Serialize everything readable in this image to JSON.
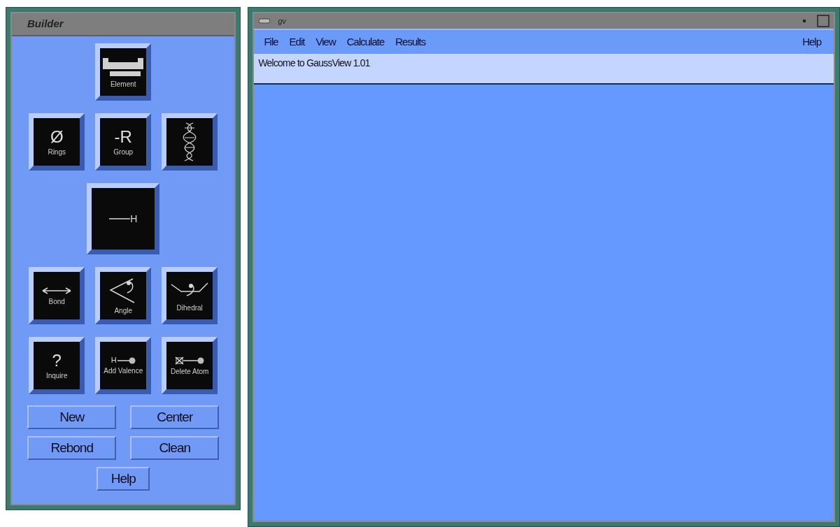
{
  "builder": {
    "title": "Builder",
    "tool_rows": [
      [
        {
          "kind": "element",
          "label": "Element"
        }
      ],
      [
        {
          "kind": "rings",
          "symbol": "Ø",
          "label": "Rings"
        },
        {
          "kind": "group",
          "symbol": "-R",
          "label": "Group"
        },
        {
          "kind": "helix"
        }
      ],
      [
        {
          "kind": "hydrogen",
          "symbol": "H"
        }
      ],
      [
        {
          "kind": "bond",
          "label": "Bond"
        },
        {
          "kind": "angle",
          "label": "Angle"
        },
        {
          "kind": "dihedral",
          "label": "Dihedral"
        }
      ],
      [
        {
          "kind": "inquire",
          "symbol": "?",
          "label": "Inquire"
        },
        {
          "kind": "valence",
          "symbol": "H",
          "label": "Add Valence"
        },
        {
          "kind": "delete",
          "label": "Delete Atom"
        }
      ]
    ],
    "buttons": [
      [
        "New",
        "Center"
      ],
      [
        "Rebond",
        "Clean"
      ],
      [
        "Help"
      ]
    ]
  },
  "main_window": {
    "title": "gv",
    "menu": [
      "File",
      "Edit",
      "View",
      "Calculate",
      "Results"
    ],
    "help_menu": "Help",
    "status_message": "Welcome to GaussView 1.01"
  }
}
